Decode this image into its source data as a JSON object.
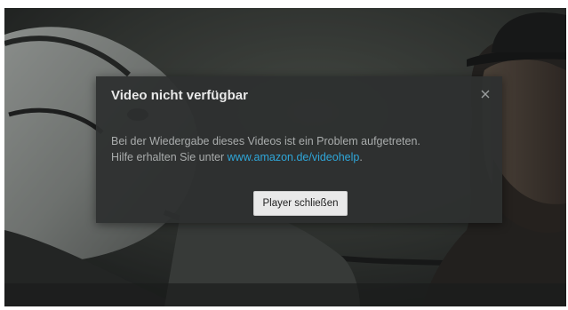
{
  "dialog": {
    "title": "Video nicht verfügbar",
    "close_icon": "close-icon",
    "message_line1": "Bei der Wiedergabe dieses Videos ist ein Problem aufgetreten.",
    "message_line2_prefix": "Hilfe erhalten Sie unter ",
    "help_link_text": "www.amazon.de/videohelp",
    "message_line2_suffix": ".",
    "close_player_label": "Player schließen"
  },
  "colors": {
    "dialog_background": "#2e3030",
    "title_text": "#e8e8e8",
    "body_text": "#a9acac",
    "link": "#2fa6d8",
    "button_background": "#e9e9e9"
  }
}
